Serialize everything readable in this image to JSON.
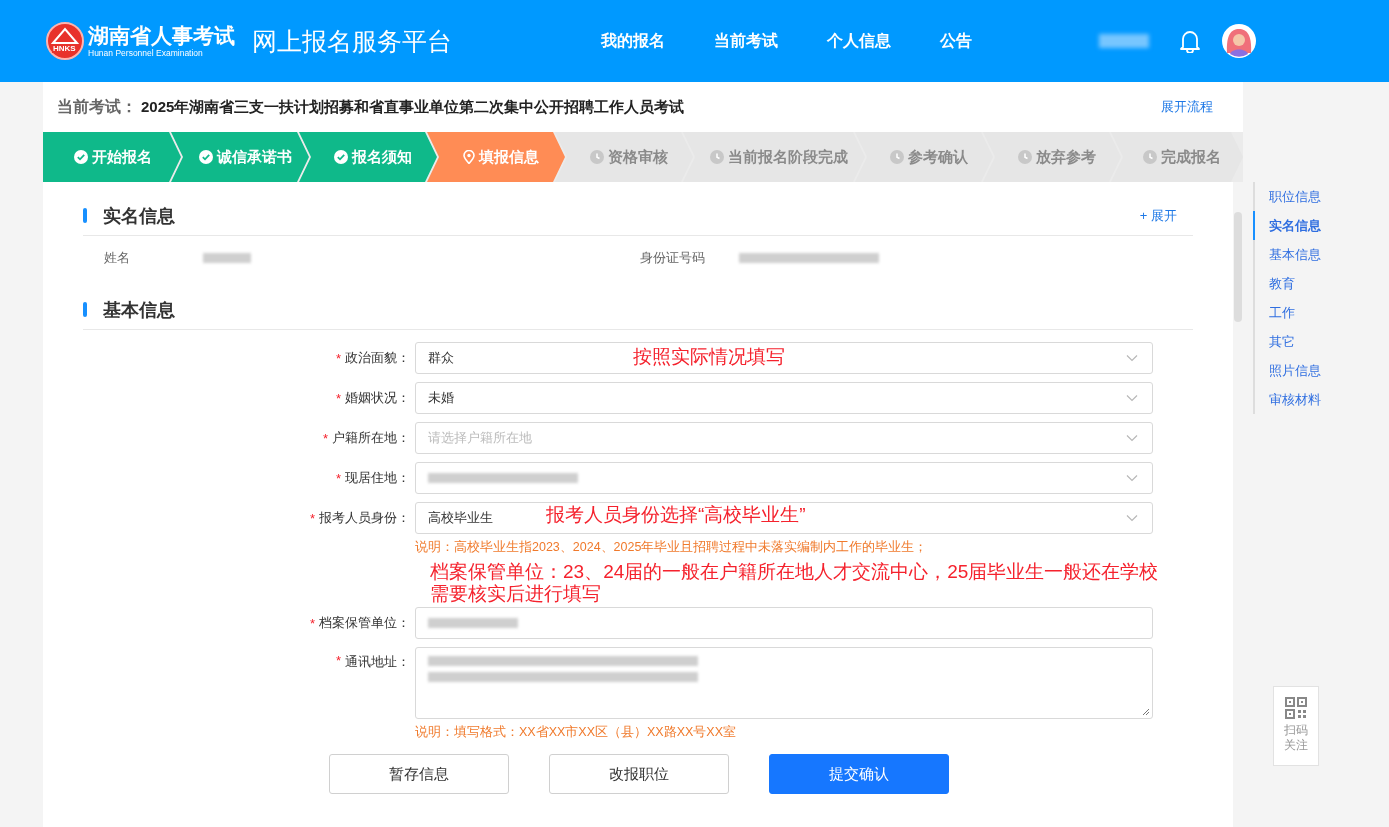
{
  "header": {
    "logo_title": "湖南省人事考试",
    "logo_subtitle": "Hunan Personnel Examination",
    "logo_badge": "HNKS",
    "platform": "网上报名服务平台",
    "nav": [
      {
        "label": "我的报名"
      },
      {
        "label": "当前考试"
      },
      {
        "label": "个人信息"
      },
      {
        "label": "公告"
      }
    ]
  },
  "exam": {
    "label": "当前考试：",
    "title": "2025年湖南省三支一扶计划招募和省直事业单位第二次集中公开招聘工作人员考试",
    "link": "展开流程"
  },
  "steps": [
    {
      "label": "开始报名",
      "done": true,
      "selected": false
    },
    {
      "label": "诚信承诺书",
      "done": true,
      "selected": false
    },
    {
      "label": "报名须知",
      "done": true,
      "selected": false
    },
    {
      "label": "填报信息",
      "done": false,
      "selected": true
    },
    {
      "label": "资格审核",
      "done": false,
      "selected": false
    },
    {
      "label": "当前报名阶段完成",
      "done": false,
      "selected": false
    },
    {
      "label": "参考确认",
      "done": false,
      "selected": false
    },
    {
      "label": "放弃参考",
      "done": false,
      "selected": false
    },
    {
      "label": "完成报名",
      "done": false,
      "selected": false
    }
  ],
  "realname": {
    "title": "实名信息",
    "expand": "+ 展开",
    "fields": [
      {
        "label": "姓名"
      },
      {
        "label": "身份证号码"
      }
    ]
  },
  "basic": {
    "title": "基本信息",
    "required_mark": "*",
    "fields": [
      {
        "label": "政治面貌：",
        "required": true,
        "kind": "select",
        "value": "群众",
        "annotation": [
          "按照实际情况填写"
        ]
      },
      {
        "label": "婚姻状况：",
        "required": true,
        "kind": "select",
        "value": "未婚"
      },
      {
        "label": "户籍所在地：",
        "required": true,
        "kind": "select",
        "placeholder": "请选择户籍所在地"
      },
      {
        "label": "现居住地：",
        "required": true,
        "kind": "select",
        "redacted": true
      },
      {
        "label": "报考人员身份：",
        "required": true,
        "kind": "select",
        "value": "高校毕业生",
        "hint": "说明：高校毕业生指2023、2024、2025年毕业且招聘过程中未落实编制内工作的毕业生；",
        "annotation": [
          "报考人员身份选择“高校毕业生”"
        ]
      },
      {
        "label": "档案保管单位：",
        "required": true,
        "kind": "input",
        "redacted": true,
        "annotation": [
          "档案保管单位：23、24届的一般在户籍所在地人才交流中心，25届毕业生一般还在学校",
          "需要核实后进行填写"
        ]
      },
      {
        "label": "通讯地址：",
        "required": true,
        "kind": "textarea",
        "redacted": true,
        "hint": "说明：填写格式：XX省XX市XX区（县）XX路XX号XX室"
      }
    ]
  },
  "buttons": [
    {
      "label": "暂存信息",
      "kind": "secondary"
    },
    {
      "label": "改报职位",
      "kind": "secondary"
    },
    {
      "label": "提交确认",
      "kind": "primary"
    }
  ],
  "side_nav": [
    {
      "label": "职位信息",
      "selected": false
    },
    {
      "label": "实名信息",
      "selected": true
    },
    {
      "label": "基本信息",
      "selected": false
    },
    {
      "label": "教育",
      "selected": false
    },
    {
      "label": "工作",
      "selected": false
    },
    {
      "label": "其它",
      "selected": false
    },
    {
      "label": "照片信息",
      "selected": false
    },
    {
      "label": "审核材料",
      "selected": false
    }
  ],
  "qr_widget": {
    "label": "扫码关注"
  }
}
